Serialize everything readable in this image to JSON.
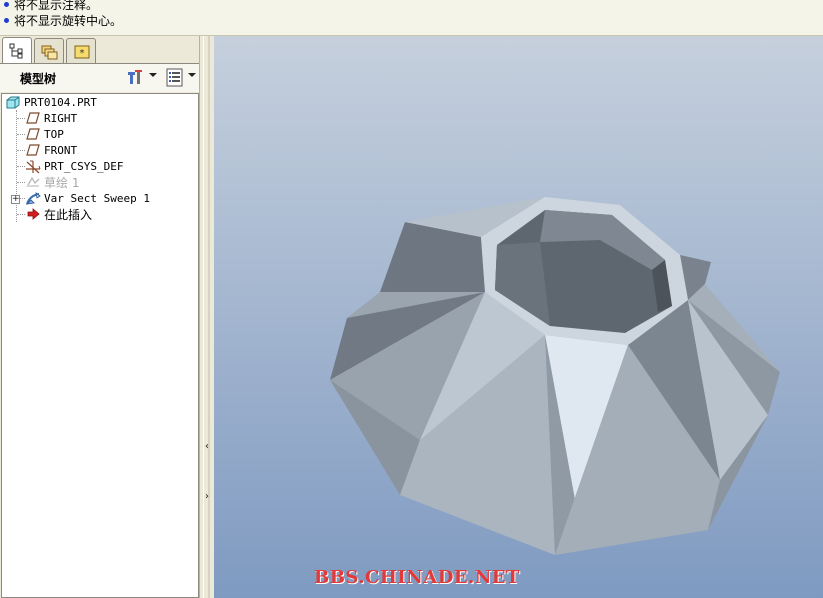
{
  "messages": [
    "将不显示注释。",
    "将不显示旋转中心。"
  ],
  "navigator": {
    "tabs": [
      "model-tree",
      "folder-browser",
      "favorites"
    ],
    "tree_title": "模型树",
    "tree_items": [
      {
        "label": "PRT0104.PRT",
        "icon": "part-icon"
      },
      {
        "label": "RIGHT",
        "icon": "datum-plane-icon"
      },
      {
        "label": "TOP",
        "icon": "datum-plane-icon"
      },
      {
        "label": "FRONT",
        "icon": "datum-plane-icon"
      },
      {
        "label": "PRT_CSYS_DEF",
        "icon": "coordinate-system-icon"
      },
      {
        "label": "草绘 1",
        "icon": "sketch-icon",
        "dimmed": true
      },
      {
        "label": "Var Sect Sweep 1",
        "icon": "sweep-feature-icon"
      },
      {
        "label": "在此插入",
        "icon": "insert-here-arrow-icon"
      }
    ]
  },
  "sash": {
    "collapse_glyph": "‹",
    "expand_glyph": "›"
  },
  "viewport": {
    "watermark": "BBS.CHINADE.NET",
    "background_colors": {
      "top": "#c6d0dd",
      "bottom": "#7f9ac1"
    },
    "model_colors": {
      "light": "#dfe8f1",
      "mid": "#a9b5c0",
      "dark": "#6e7781"
    }
  }
}
